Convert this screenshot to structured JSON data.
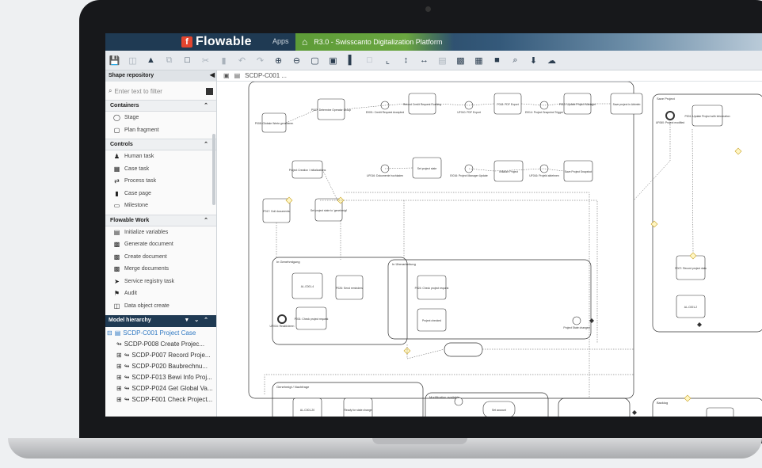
{
  "app": {
    "logo_text": "Flowable",
    "apps_label": "Apps",
    "tab_title": "R3.0 - Swisscanto Digitalization Platform",
    "brand_color": "#1f3a53",
    "accent_color": "#6aa641",
    "logo_color": "#e2452f"
  },
  "toolbar": {
    "icons": [
      "save-icon",
      "save-as-icon",
      "validate-warning-icon",
      "copy-icon",
      "paste-icon",
      "cut-icon",
      "delete-icon",
      "undo-icon",
      "redo-icon",
      "zoom-in-icon",
      "zoom-out-icon",
      "fit-icon",
      "fullscreen-icon",
      "align-left-icon",
      "align-bottom-icon",
      "align-middle-icon",
      "align-center-icon",
      "comment-icon",
      "bold-icon",
      "image-icon",
      "publish-icon",
      "zoom-actual-icon",
      "download-icon",
      "upload-icon"
    ]
  },
  "sidebar": {
    "title": "Shape repository",
    "filter_placeholder": "Enter text to filter",
    "sections": [
      {
        "title": "Containers",
        "items": [
          {
            "label": "Stage",
            "icon": "stage-icon"
          },
          {
            "label": "Plan fragment",
            "icon": "plan-fragment-icon"
          }
        ]
      },
      {
        "title": "Controls",
        "items": [
          {
            "label": "Human task",
            "icon": "human-task-icon"
          },
          {
            "label": "Case task",
            "icon": "case-task-icon"
          },
          {
            "label": "Process task",
            "icon": "process-task-icon"
          },
          {
            "label": "Case page",
            "icon": "case-page-icon"
          },
          {
            "label": "Milestone",
            "icon": "milestone-icon"
          }
        ]
      },
      {
        "title": "Flowable Work",
        "items": [
          {
            "label": "Initialize variables",
            "icon": "initialize-variables-icon"
          },
          {
            "label": "Generate document",
            "icon": "generate-document-icon"
          },
          {
            "label": "Create document",
            "icon": "create-document-icon"
          },
          {
            "label": "Merge documents",
            "icon": "merge-documents-icon"
          },
          {
            "label": "Service registry task",
            "icon": "service-registry-icon"
          },
          {
            "label": "Audit",
            "icon": "audit-icon"
          },
          {
            "label": "Data object create",
            "icon": "data-object-icon"
          }
        ]
      }
    ]
  },
  "hierarchy": {
    "title": "Model hierarchy",
    "root": "SCDP-C001 Project Case",
    "children": [
      "SCDP-P008 Create Projec...",
      "SCDP-P007 Record Proje...",
      "SCDP-P020 Baubrechnu...",
      "SCDP-F013 Bewi Info Proj...",
      "SCDP-P024 Get Global Va...",
      "SCDP-F001 Check Project..."
    ]
  },
  "canvas": {
    "tab_label": "SCDP-C001 ...",
    "stage_labels": [
      "In Genehmigung",
      "In Überarbeitung",
      "Save Project",
      "Genehmigt / Nachfrage",
      "Modification available",
      "Backlog",
      "gestartet",
      "ausstehend"
    ],
    "task_labels": [
      "P008: Globale Werte generieren",
      "P007: Determine Operator Group",
      "Record Credit Request Running",
      "P018: PDF Export",
      "P010: Update Project Manager",
      "Save project in Abbrieb",
      "Project Creation / Initializations",
      "Set project state",
      "Initialize Project",
      "Save Project Snapshot",
      "P017: Doll documents",
      "Set project state to 'genehmigt'",
      "AL-C001-4",
      "P026: Send reminders",
      "P001: Check project request",
      "P024: Check project request",
      "Project checked",
      "P001: Update Project with Information",
      "P007: Record project data",
      "AL-C001-2",
      "AL-C001-20",
      "Ready for state change",
      "Set account"
    ],
    "event_labels": [
      "EI001: Credit Request Accepted",
      "UF010: PDF Export",
      "EI014: Project Snapshot Trigger",
      "UF016: Dokumente hochladen",
      "EI016: Project Manager Update",
      "UF016: Projekt ablehnen",
      "UF060: Project modified",
      "UF016: Reaktivieren",
      "Project State changed"
    ]
  }
}
